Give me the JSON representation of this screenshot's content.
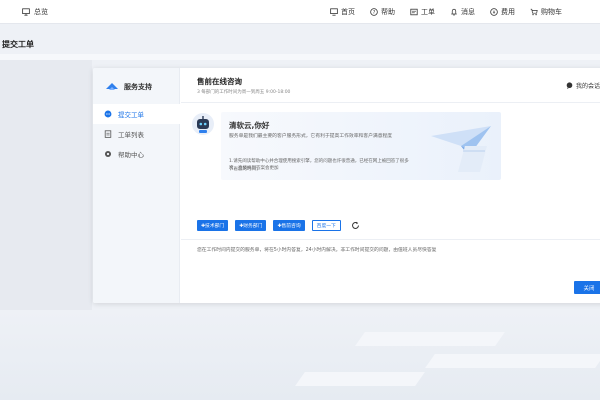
{
  "topbar": {
    "console_label": "总览",
    "nav": [
      {
        "label": "首页",
        "icon": "monitor-icon"
      },
      {
        "label": "帮助",
        "icon": "help-circle-icon"
      },
      {
        "label": "工单",
        "icon": "ticket-icon"
      },
      {
        "label": "消息",
        "icon": "bell-icon"
      },
      {
        "label": "费用",
        "icon": "coin-icon"
      },
      {
        "label": "购物车",
        "icon": "cart-icon"
      }
    ]
  },
  "page": {
    "title": "提交工单"
  },
  "dialog": {
    "sidebar": {
      "title": "服务支持",
      "items": [
        {
          "label": "提交工单",
          "icon": "chat-bubble-icon",
          "active": true
        },
        {
          "label": "工单列表",
          "icon": "clipboard-icon",
          "active": false
        },
        {
          "label": "帮助中心",
          "icon": "gear-icon",
          "active": false
        }
      ]
    },
    "main": {
      "title": "售前在线咨询",
      "subtitle": "3 每部门的工作时间为周一到周五 9:00-18:00",
      "my_tickets": "我的会话",
      "greeting_title": "清软云,你好",
      "greeting_sub": "服务单是我们最主要的客户服务形式，它有利于提高工作效率和客户满意程度",
      "tip_line1": "1.请先阅读帮助中心并合理使用搜索引擎，您的问题也许很普通，已经在网上被回答了很多次，直接找到答案会更加",
      "tip_line2": "节省您的时间；",
      "buttons": [
        {
          "label": "✚技术部门",
          "style": "solid"
        },
        {
          "label": "✚财务部门",
          "style": "solid"
        },
        {
          "label": "✚售前咨询",
          "style": "solid"
        },
        {
          "label": "百度一下",
          "style": "outline"
        }
      ],
      "notice": "您在工作时间内提交的服务单，将在5小时内答复，24小时内解决。非工作时间提交的问题，由值班人员尽快答复",
      "close_label": "关闭"
    }
  },
  "colors": {
    "accent": "#1a73e8"
  }
}
